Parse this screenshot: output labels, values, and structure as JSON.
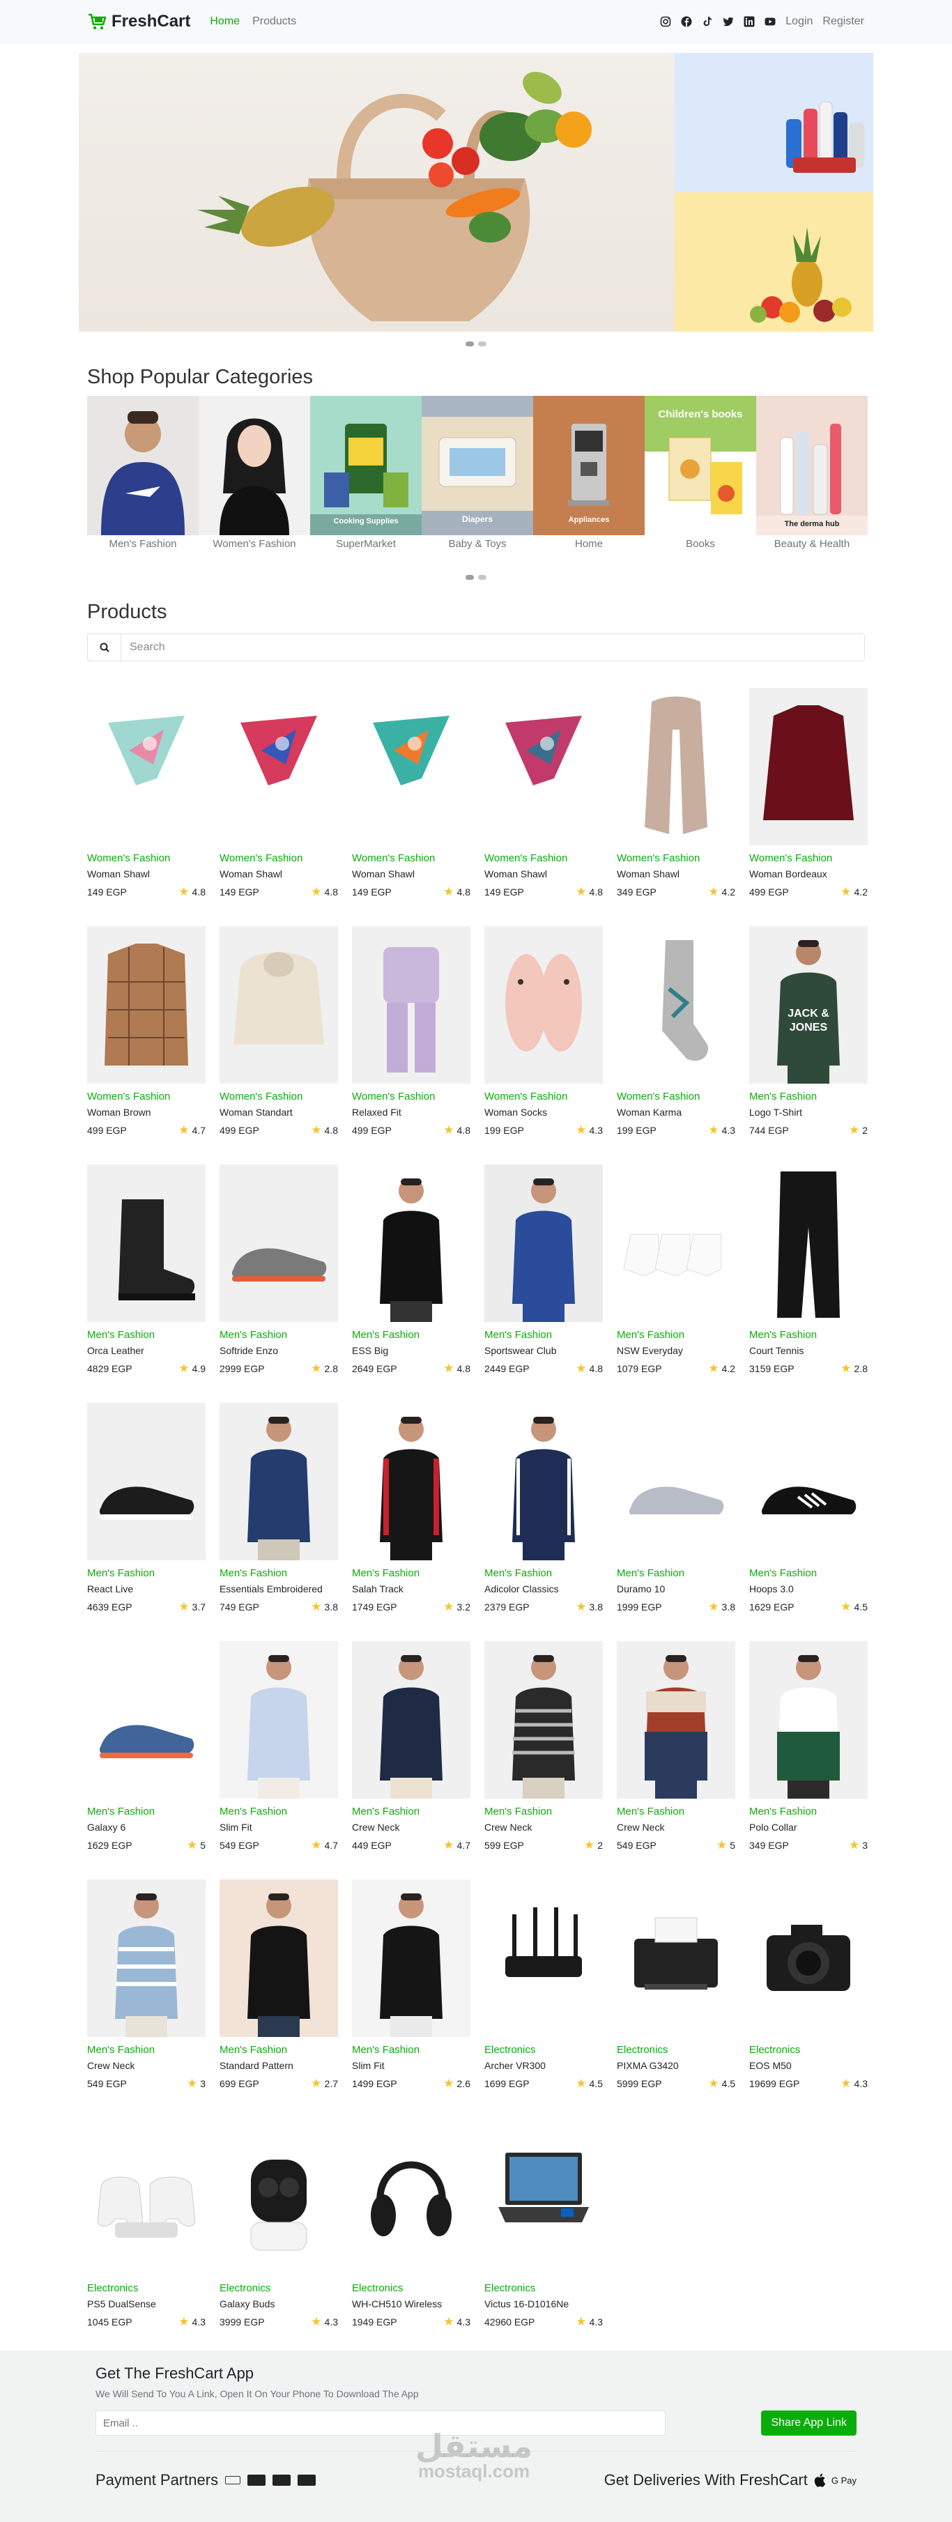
{
  "nav": {
    "brand": "FreshCart",
    "links": [
      "Home",
      "Products"
    ],
    "login": "Login",
    "register": "Register"
  },
  "colors": {
    "accent": "#0aad0a",
    "star": "#f4c430"
  },
  "categories": {
    "title": "Shop Popular Categories",
    "items": [
      {
        "name": "Men's Fashion"
      },
      {
        "name": "Women's Fashion"
      },
      {
        "name": "SuperMarket",
        "img_text": "Cooking Supplies"
      },
      {
        "name": "Baby & Toys",
        "img_text": "Diapers"
      },
      {
        "name": "Home",
        "img_text": "Appliances"
      },
      {
        "name": "Books",
        "img_text": "Children's books"
      },
      {
        "name": "Beauty & Health",
        "img_text": "The derma hub"
      }
    ]
  },
  "products": {
    "title": "Products",
    "search_placeholder": "Search",
    "items": [
      {
        "cat": "Women's Fashion",
        "name": "Woman Shawl",
        "price": "149 EGP",
        "rating": "4.8",
        "img": "shawl1"
      },
      {
        "cat": "Women's Fashion",
        "name": "Woman Shawl",
        "price": "149 EGP",
        "rating": "4.8",
        "img": "shawl2"
      },
      {
        "cat": "Women's Fashion",
        "name": "Woman Shawl",
        "price": "149 EGP",
        "rating": "4.8",
        "img": "shawl3"
      },
      {
        "cat": "Women's Fashion",
        "name": "Woman Shawl",
        "price": "149 EGP",
        "rating": "4.8",
        "img": "shawl4"
      },
      {
        "cat": "Women's Fashion",
        "name": "Woman Shawl",
        "price": "349 EGP",
        "rating": "4.2",
        "img": "scarf"
      },
      {
        "cat": "Women's Fashion",
        "name": "Woman Bordeaux",
        "price": "499 EGP",
        "rating": "4.2",
        "img": "shirt-bordeaux"
      },
      {
        "cat": "Women's Fashion",
        "name": "Woman Brown",
        "price": "499 EGP",
        "rating": "4.7",
        "img": "shirt-brown"
      },
      {
        "cat": "Women's Fashion",
        "name": "Woman Standart",
        "price": "499 EGP",
        "rating": "4.8",
        "img": "hoodie-cream"
      },
      {
        "cat": "Women's Fashion",
        "name": "Relaxed Fit",
        "price": "499 EGP",
        "rating": "4.8",
        "img": "lilac-set"
      },
      {
        "cat": "Women's Fashion",
        "name": "Woman Socks",
        "price": "199 EGP",
        "rating": "4.3",
        "img": "slippers"
      },
      {
        "cat": "Women's Fashion",
        "name": "Woman Karma",
        "price": "199 EGP",
        "rating": "4.3",
        "img": "sock"
      },
      {
        "cat": "Men's Fashion",
        "name": "Logo T-Shirt",
        "price": "744 EGP",
        "rating": "2",
        "img": "tshirt-jj"
      },
      {
        "cat": "Men's Fashion",
        "name": "Orca Leather",
        "price": "4829 EGP",
        "rating": "4.9",
        "img": "boot"
      },
      {
        "cat": "Men's Fashion",
        "name": "Softride Enzo",
        "price": "2999 EGP",
        "rating": "2.8",
        "img": "shoe-grey"
      },
      {
        "cat": "Men's Fashion",
        "name": "ESS Big",
        "price": "2649 EGP",
        "rating": "4.8",
        "img": "hoodie-black"
      },
      {
        "cat": "Men's Fashion",
        "name": "Sportswear Club",
        "price": "2449 EGP",
        "rating": "4.8",
        "img": "tracksuit-blue"
      },
      {
        "cat": "Men's Fashion",
        "name": "NSW Everyday",
        "price": "1079 EGP",
        "rating": "4.2",
        "img": "socks-white"
      },
      {
        "cat": "Men's Fashion",
        "name": "Court Tennis",
        "price": "3159 EGP",
        "rating": "2.8",
        "img": "pants-black"
      },
      {
        "cat": "Men's Fashion",
        "name": "React Live",
        "price": "4639 EGP",
        "rating": "3.7",
        "img": "sneaker-black"
      },
      {
        "cat": "Men's Fashion",
        "name": "Essentials Embroidered",
        "price": "749 EGP",
        "rating": "3.8",
        "img": "tshirt-navy"
      },
      {
        "cat": "Men's Fashion",
        "name": "Salah Track",
        "price": "1749 EGP",
        "rating": "3.2",
        "img": "jacket-track"
      },
      {
        "cat": "Men's Fashion",
        "name": "Adicolor Classics",
        "price": "2379 EGP",
        "rating": "3.8",
        "img": "track-navy"
      },
      {
        "cat": "Men's Fashion",
        "name": "Duramo 10",
        "price": "1999 EGP",
        "rating": "3.8",
        "img": "sneaker-silver"
      },
      {
        "cat": "Men's Fashion",
        "name": "Hoops 3.0",
        "price": "1629 EGP",
        "rating": "4.5",
        "img": "sneaker-bw"
      },
      {
        "cat": "Men's Fashion",
        "name": "Galaxy 6",
        "price": "1629 EGP",
        "rating": "5",
        "img": "sneaker-blue"
      },
      {
        "cat": "Men's Fashion",
        "name": "Slim Fit",
        "price": "549 EGP",
        "rating": "4.7",
        "img": "shirt-lightblue"
      },
      {
        "cat": "Men's Fashion",
        "name": "Crew Neck",
        "price": "449 EGP",
        "rating": "4.7",
        "img": "sweater-navy"
      },
      {
        "cat": "Men's Fashion",
        "name": "Crew Neck",
        "price": "599 EGP",
        "rating": "2",
        "img": "sweater-stripe"
      },
      {
        "cat": "Men's Fashion",
        "name": "Crew Neck",
        "price": "549 EGP",
        "rating": "5",
        "img": "sweater-block"
      },
      {
        "cat": "Men's Fashion",
        "name": "Polo Collar",
        "price": "349 EGP",
        "rating": "3",
        "img": "polo-green"
      },
      {
        "cat": "Men's Fashion",
        "name": "Crew Neck",
        "price": "549 EGP",
        "rating": "3",
        "img": "sweater-lightstripe"
      },
      {
        "cat": "Men's Fashion",
        "name": "Standard Pattern",
        "price": "699 EGP",
        "rating": "2.7",
        "img": "pajama"
      },
      {
        "cat": "Men's Fashion",
        "name": "Slim Fit",
        "price": "1499 EGP",
        "rating": "2.6",
        "img": "leather-jacket"
      },
      {
        "cat": "Electronics",
        "name": "Archer VR300",
        "price": "1699 EGP",
        "rating": "4.5",
        "img": "router"
      },
      {
        "cat": "Electronics",
        "name": "PIXMA G3420",
        "price": "5999 EGP",
        "rating": "4.5",
        "img": "printer"
      },
      {
        "cat": "Electronics",
        "name": "EOS M50",
        "price": "19699 EGP",
        "rating": "4.3",
        "img": "camera"
      },
      {
        "cat": "Electronics",
        "name": "PS5 DualSense",
        "price": "1045 EGP",
        "rating": "4.3",
        "img": "controllers"
      },
      {
        "cat": "Electronics",
        "name": "Galaxy Buds",
        "price": "3999 EGP",
        "rating": "4.3",
        "img": "buds"
      },
      {
        "cat": "Electronics",
        "name": "WH-CH510 Wireless",
        "price": "1949 EGP",
        "rating": "4.3",
        "img": "headphones"
      },
      {
        "cat": "Electronics",
        "name": "Victus 16-D1016Ne",
        "price": "42960 EGP",
        "rating": "4.3",
        "img": "laptop"
      }
    ]
  },
  "footer": {
    "title": "Get The FreshCart App",
    "subtitle": "We Will Send To You A Link, Open It On Your Phone To Download The App",
    "email_placeholder": "Email ..",
    "share_label": "Share App Link",
    "payment_partners": "Payment Partners",
    "deliveries": "Get Deliveries With FreshCart",
    "watermark_ar": "مستقل",
    "watermark_en": "mostaql.com"
  }
}
